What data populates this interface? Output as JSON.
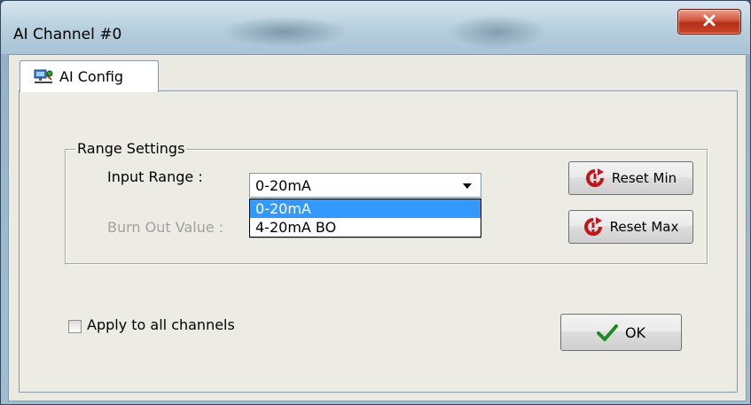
{
  "window": {
    "title": "AI Channel #0",
    "close_icon": "close-x-icon"
  },
  "tabs": [
    {
      "label": "AI Config",
      "icon": "network-config-icon",
      "active": true
    }
  ],
  "range_settings": {
    "legend": "Range Settings",
    "input_range_label": "Input Range :",
    "input_range_value": "0-20mA",
    "burn_out_label": "Burn Out Value :",
    "dropdown_options": [
      {
        "label": "0-20mA",
        "selected": true
      },
      {
        "label": "4-20mA BO",
        "selected": false
      }
    ]
  },
  "buttons": {
    "reset_min": "Reset Min",
    "reset_max": "Reset Max",
    "ok": "OK",
    "reset_icon": "reset-arrow-icon",
    "ok_icon": "checkmark-icon"
  },
  "apply_all": {
    "label": "Apply to all channels",
    "checked": false
  },
  "colors": {
    "selection": "#3399ff",
    "close_button": "#c8482c",
    "ok_check": "#1f8a1f",
    "reset_icon": "#c0161b"
  }
}
